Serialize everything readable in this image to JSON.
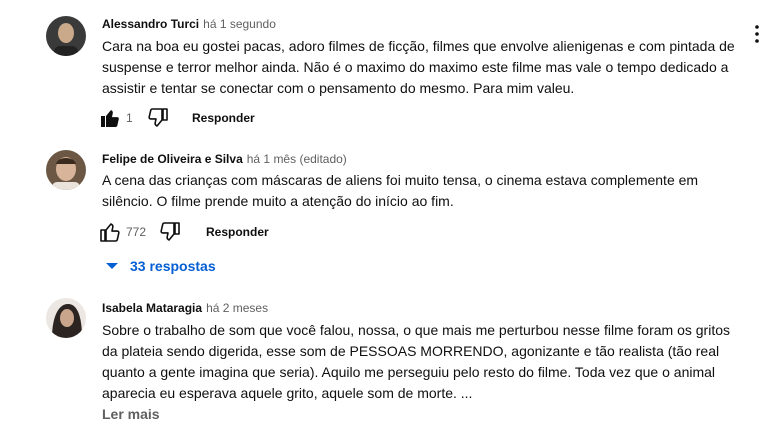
{
  "comments": [
    {
      "author": "Alessandro Turci",
      "time": "há 1 segundo",
      "lines": [
        "Cara na boa eu gostei pacas, adoro filmes de ficção, filmes que envolve alienigenas e com pintada de",
        "suspense e terror melhor ainda. Não é o maximo do maximo este filme mas vale o tempo dedicado a",
        "assistir e tentar se conectar com o pensamento do mesmo. Para mim valeu."
      ],
      "likes": "1",
      "liked": true,
      "reply_label": "Responder",
      "avatar_colors": [
        "#3a3a3a",
        "#c9a98a"
      ]
    },
    {
      "author": "Felipe de Oliveira e Silva",
      "time": "há 1 mês (editado)",
      "lines": [
        "A cena das crianças com máscaras de aliens foi muito tensa, o cinema estava complemente em",
        "silêncio. O filme prende muito a atenção do início ao fim."
      ],
      "likes": "772",
      "liked": false,
      "reply_label": "Responder",
      "replies_label": "33 respostas",
      "avatar_colors": [
        "#6b5744",
        "#d8b59a"
      ]
    },
    {
      "author": "Isabela Mataragia",
      "time": "há 2 meses",
      "lines": [
        "Sobre o trabalho de som que você falou, nossa, o que mais me perturbou nesse filme foram os gritos",
        "da plateia sendo digerida, esse som de PESSOAS MORRENDO, agonizante e tão realista (tão real",
        "quanto a gente imagina que seria). Aquilo me perseguiu pelo resto do filme. Toda vez que o animal",
        "aparecia eu esperava aquele grito, aquele som de morte. ..."
      ],
      "read_more": "Ler mais",
      "avatar_colors": [
        "#2b2420",
        "#c8a58b"
      ]
    }
  ],
  "icons": {
    "like": "thumb-up-icon",
    "dislike": "thumb-down-icon",
    "menu": "more-vert-icon",
    "expand": "chevron-down-icon"
  },
  "colors": {
    "link_blue": "#065fd4",
    "secondary_text": "#606060"
  }
}
